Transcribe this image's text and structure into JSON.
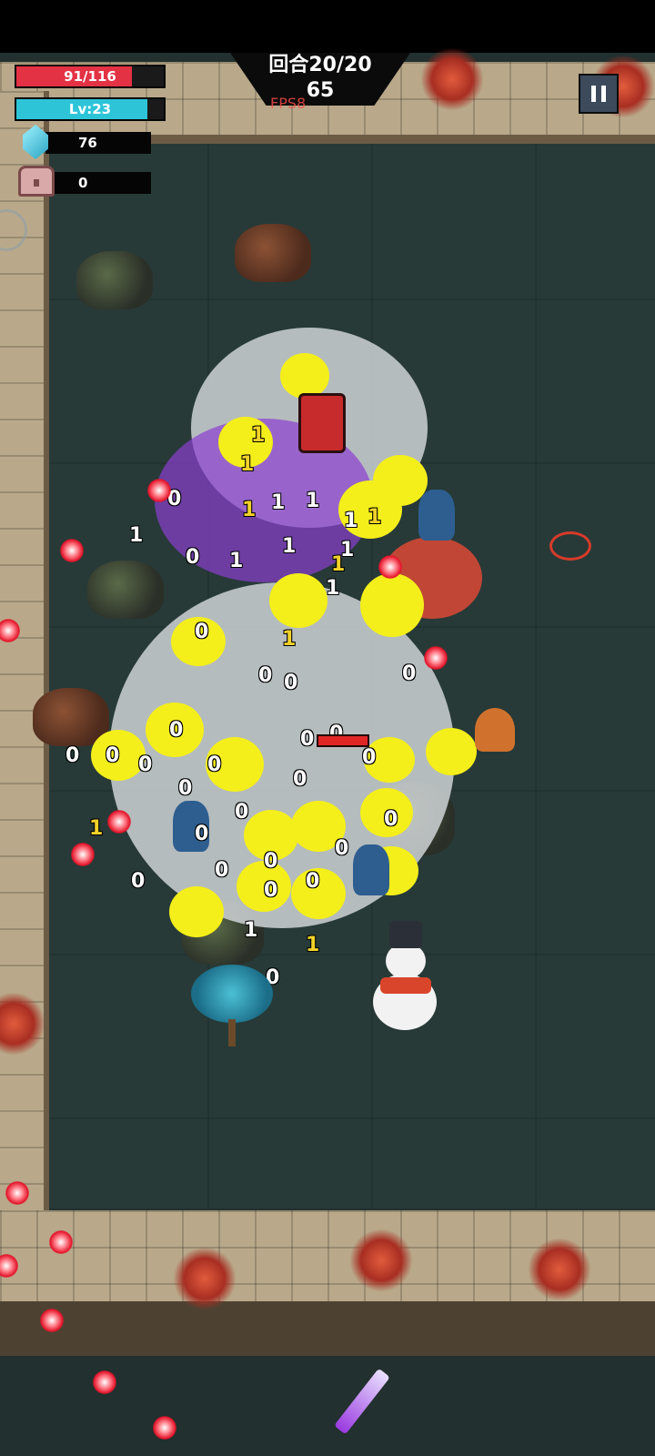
{
  "hud": {
    "hp": {
      "text": "91/116",
      "fraction": 0.784,
      "color": "#e33244"
    },
    "level": {
      "text": "Lv:23",
      "fraction": 0.89,
      "color": "#2ec4d8"
    },
    "gems": {
      "count": "76",
      "icon": "gem-icon"
    },
    "chests": {
      "count": "0",
      "icon": "chest-icon"
    },
    "wave": "回合20/20",
    "timer": "65",
    "fps": "FPS8",
    "pause_icon": "pause-icon"
  },
  "colors": {
    "floor": "#273a38",
    "wall": "#b9a98a",
    "fx_yellow": "#f4ef1a",
    "projectile": "#e3142a"
  },
  "damage_numbers": {
    "white": [
      "1",
      "0",
      "1",
      "1",
      "1",
      "1",
      "1",
      "1",
      "1",
      "1",
      "0",
      "0",
      "0",
      "0",
      "0",
      "0",
      "0",
      "0",
      "0",
      "0",
      "0",
      "0",
      "0",
      "0",
      "0",
      "0",
      "0",
      "0",
      "0",
      "0",
      "0",
      "0",
      "0",
      "0",
      "0"
    ],
    "yellow": [
      "1",
      "1",
      "1",
      "1",
      "1",
      "1",
      "1",
      "1"
    ]
  }
}
